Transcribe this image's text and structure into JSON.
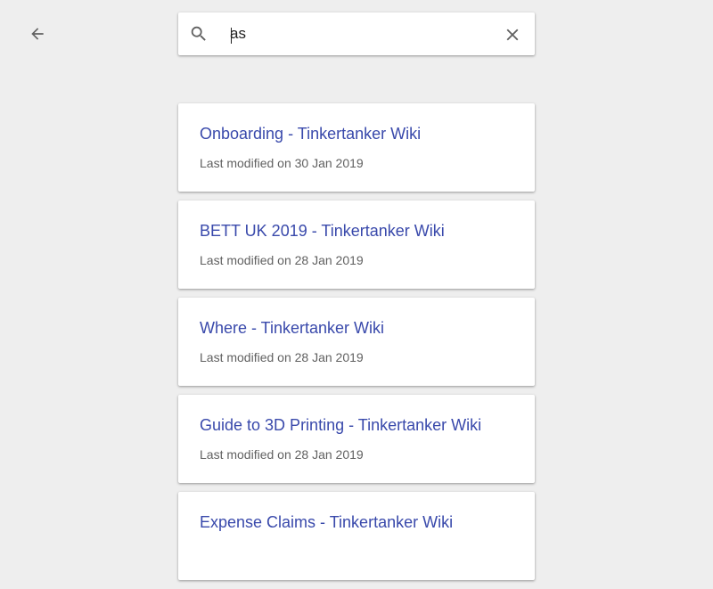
{
  "header": {
    "back_icon": "arrow-left-icon"
  },
  "search": {
    "icon": "search-icon",
    "value": "as",
    "clear_icon": "close-icon"
  },
  "results": [
    {
      "title": "Onboarding - Tinkertanker Wiki",
      "meta": "Last modified on 30 Jan 2019"
    },
    {
      "title": "BETT UK 2019 - Tinkertanker Wiki",
      "meta": "Last modified on 28 Jan 2019"
    },
    {
      "title": "Where - Tinkertanker Wiki",
      "meta": "Last modified on 28 Jan 2019"
    },
    {
      "title": "Guide to 3D Printing - Tinkertanker Wiki",
      "meta": "Last modified on 28 Jan 2019"
    },
    {
      "title": "Expense Claims - Tinkertanker Wiki",
      "meta": ""
    }
  ],
  "colors": {
    "background": "#eeeeee",
    "link": "#3949ab",
    "meta_text": "#616161",
    "icon": "#616161"
  }
}
